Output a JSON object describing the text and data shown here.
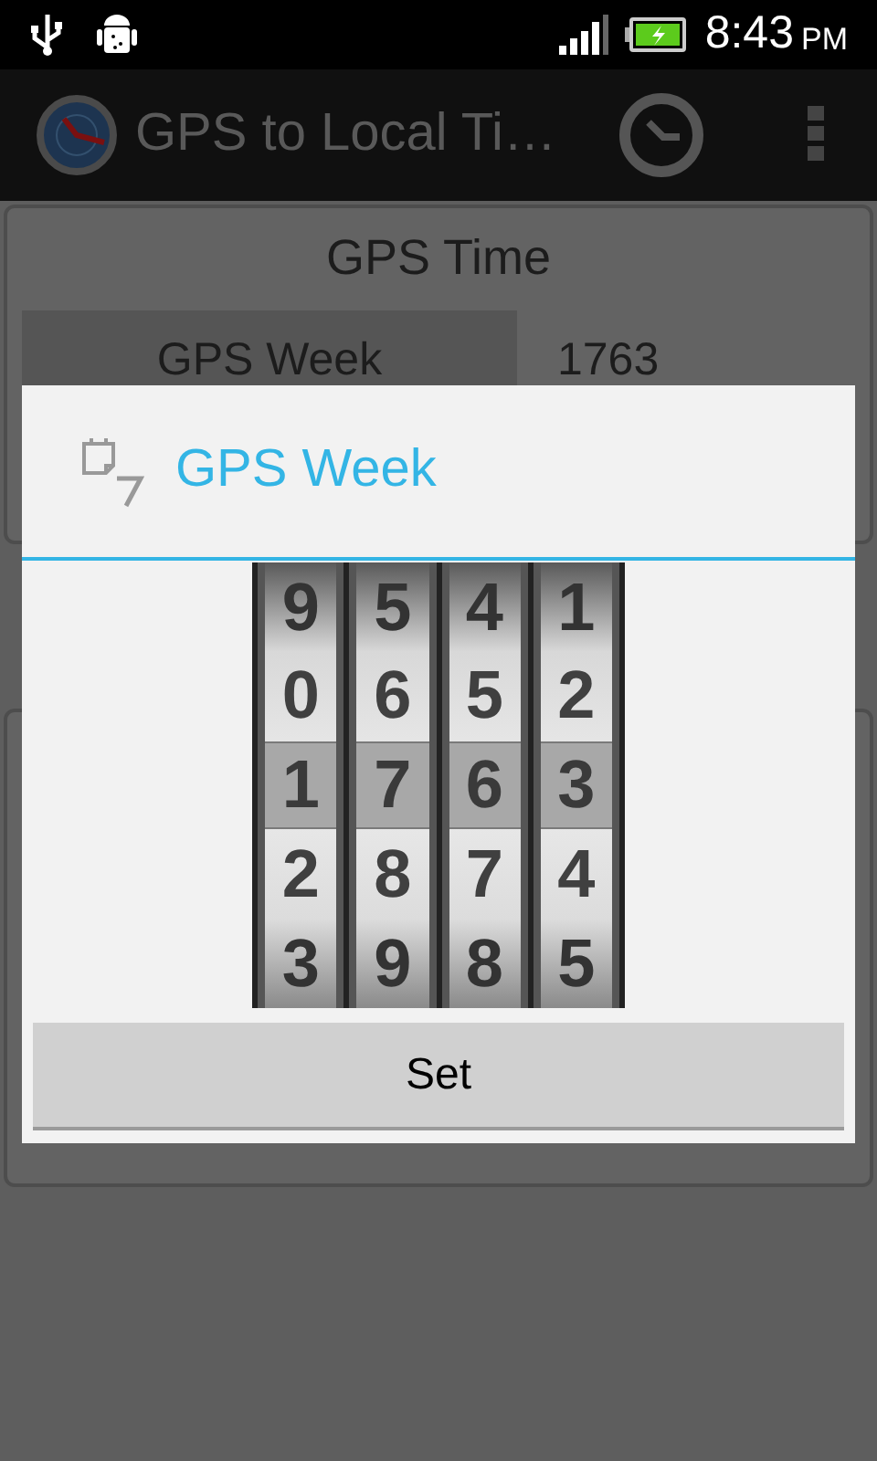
{
  "status_bar": {
    "time": "8:43",
    "ampm": "PM"
  },
  "action_bar": {
    "title": "GPS to Local Ti…"
  },
  "card": {
    "title": "GPS Time",
    "rows": [
      {
        "label": "GPS Week",
        "value": "1763"
      }
    ]
  },
  "dialog": {
    "title": "GPS Week",
    "wheels": [
      [
        {
          "digit": "9",
          "selected": false
        },
        {
          "digit": "0",
          "selected": false
        },
        {
          "digit": "1",
          "selected": true
        },
        {
          "digit": "2",
          "selected": false
        },
        {
          "digit": "3",
          "selected": false
        }
      ],
      [
        {
          "digit": "5",
          "selected": false
        },
        {
          "digit": "6",
          "selected": false
        },
        {
          "digit": "7",
          "selected": true
        },
        {
          "digit": "8",
          "selected": false
        },
        {
          "digit": "9",
          "selected": false
        }
      ],
      [
        {
          "digit": "4",
          "selected": false
        },
        {
          "digit": "5",
          "selected": false
        },
        {
          "digit": "6",
          "selected": true
        },
        {
          "digit": "7",
          "selected": false
        },
        {
          "digit": "8",
          "selected": false
        }
      ],
      [
        {
          "digit": "1",
          "selected": false
        },
        {
          "digit": "2",
          "selected": false
        },
        {
          "digit": "3",
          "selected": true
        },
        {
          "digit": "4",
          "selected": false
        },
        {
          "digit": "5",
          "selected": false
        }
      ]
    ],
    "button": "Set"
  }
}
